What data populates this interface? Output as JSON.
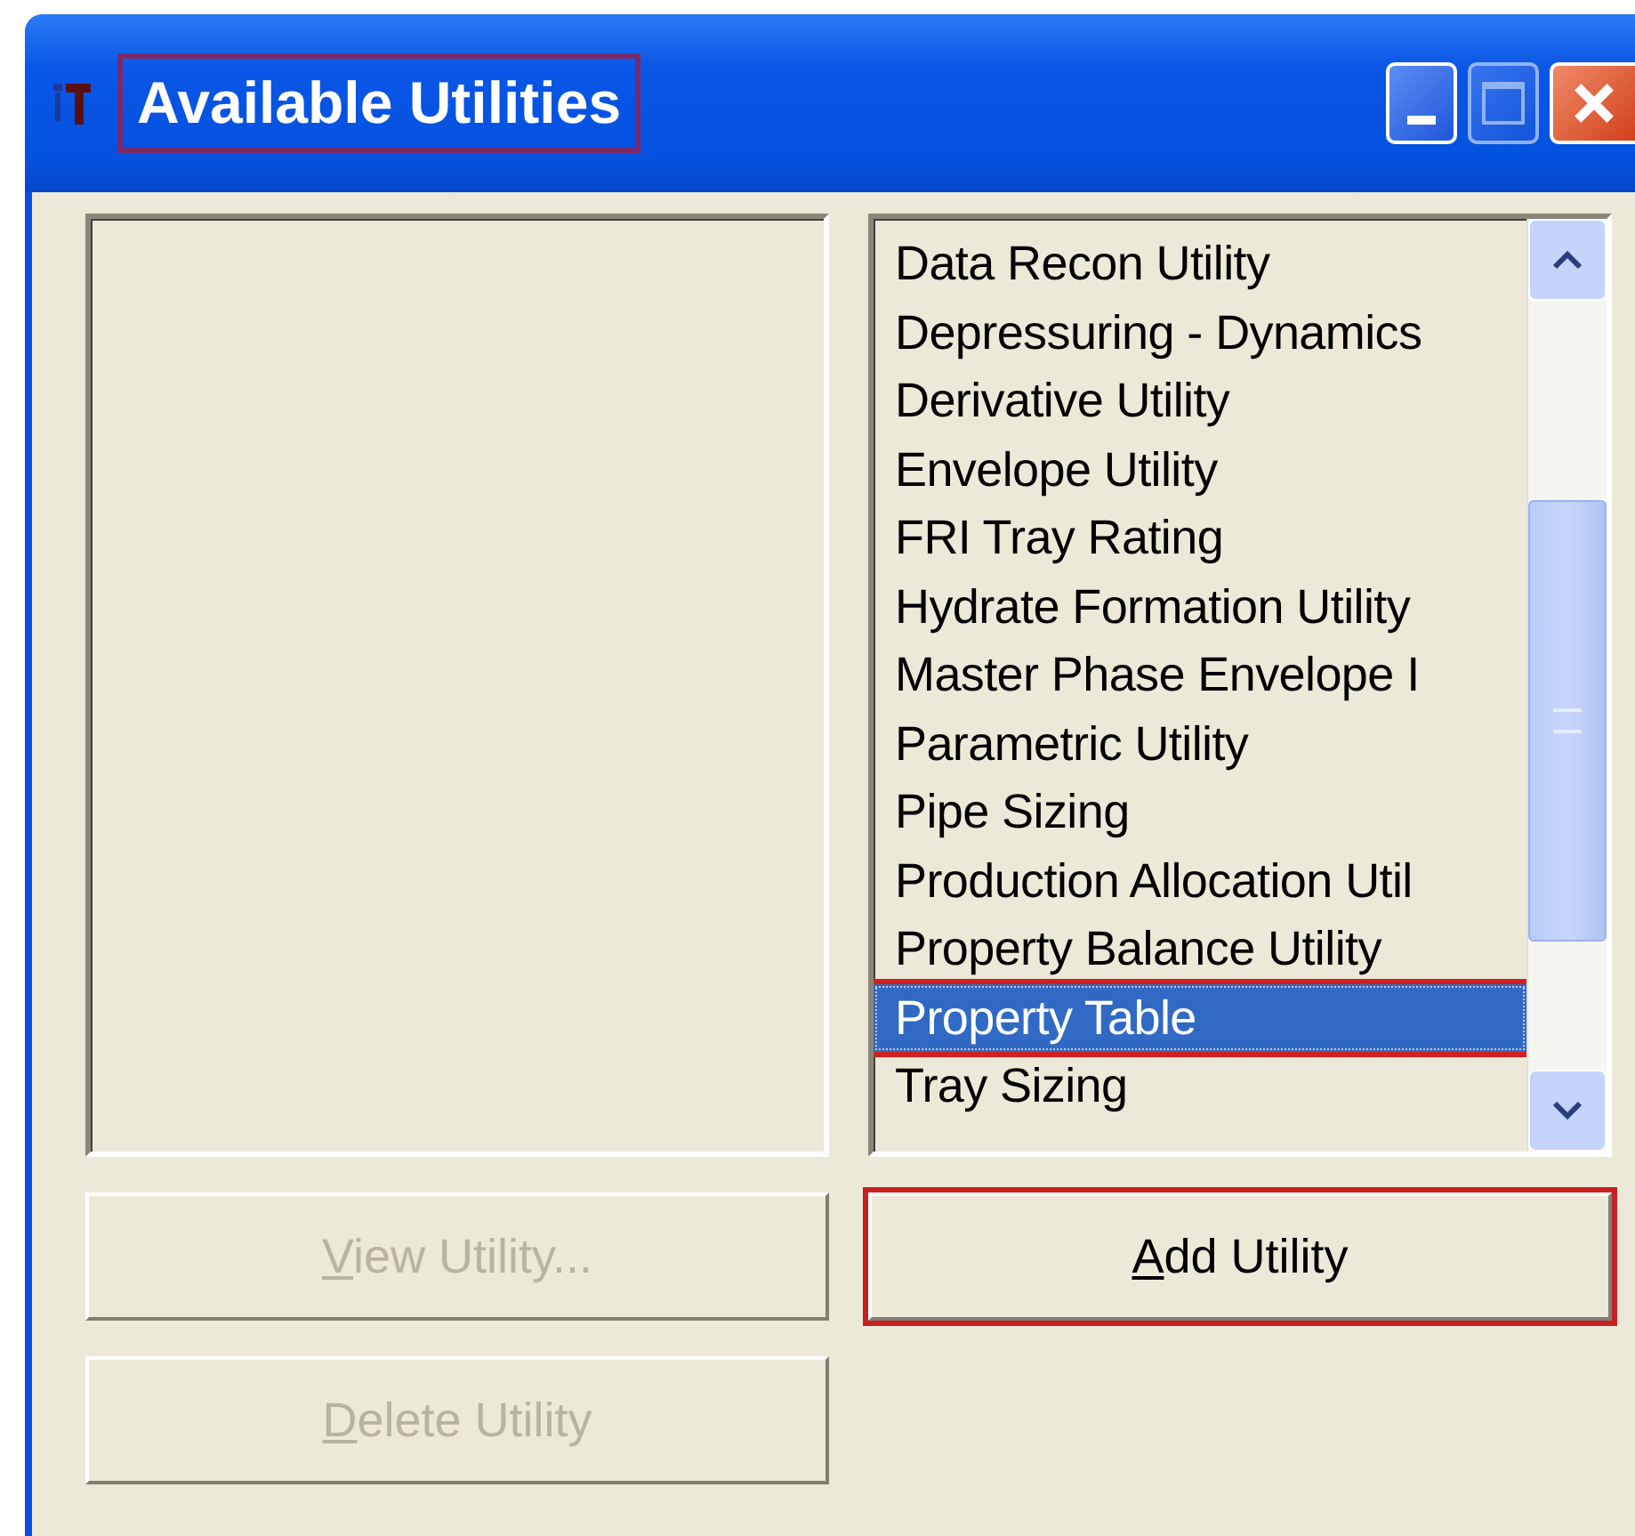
{
  "window": {
    "title": "Available Utilities",
    "title_highlighted": true
  },
  "window_buttons": [
    {
      "kind": "minimize"
    },
    {
      "kind": "maximize"
    },
    {
      "kind": "close"
    }
  ],
  "utility_list": {
    "items": [
      {
        "label": "Data Recon Utility",
        "selected": false
      },
      {
        "label": "Depressuring - Dynamics",
        "selected": false
      },
      {
        "label": "Derivative Utility",
        "selected": false
      },
      {
        "label": "Envelope Utility",
        "selected": false
      },
      {
        "label": "FRI Tray Rating",
        "selected": false
      },
      {
        "label": "Hydrate Formation Utility",
        "selected": false
      },
      {
        "label": "Master Phase Envelope I",
        "selected": false
      },
      {
        "label": "Parametric Utility",
        "selected": false
      },
      {
        "label": "Pipe Sizing",
        "selected": false
      },
      {
        "label": "Production Allocation Util",
        "selected": false
      },
      {
        "label": "Property Balance Utility",
        "selected": false
      },
      {
        "label": "Property Table",
        "selected": true,
        "highlighted": true
      },
      {
        "label": "Tray Sizing",
        "selected": false
      }
    ]
  },
  "buttons": [
    {
      "access_key": "V",
      "label_rest": "iew Utility...",
      "disabled": true,
      "highlighted": false
    },
    {
      "access_key": "A",
      "label_rest": "dd Utility",
      "disabled": false,
      "highlighted": true
    },
    {
      "access_key": "D",
      "label_rest": "elete Utility",
      "disabled": true,
      "highlighted": false
    }
  ]
}
